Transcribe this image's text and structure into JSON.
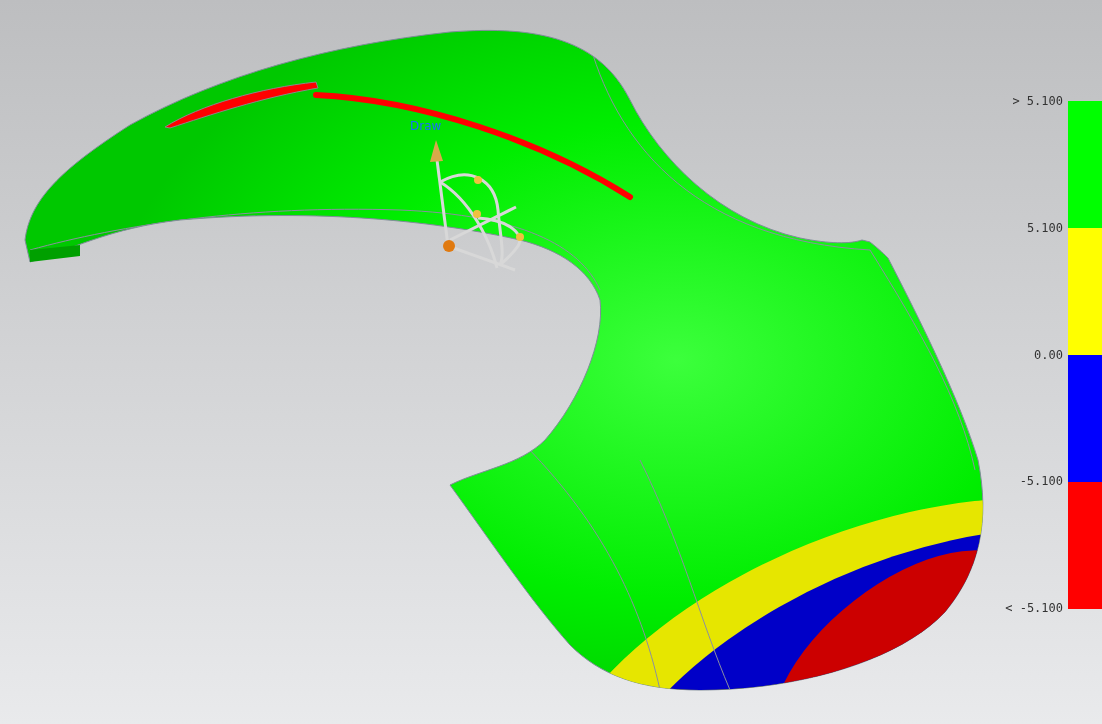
{
  "viewport": {
    "handle_label": "Draw"
  },
  "legend": {
    "labels": [
      "> 5.100",
      "5.100",
      "0.00",
      "-5.100",
      "< -5.100"
    ],
    "bands": [
      {
        "color": "#00ff00"
      },
      {
        "color": "#ffff00"
      },
      {
        "color": "#0000ff"
      },
      {
        "color": "#ff0000"
      }
    ]
  }
}
